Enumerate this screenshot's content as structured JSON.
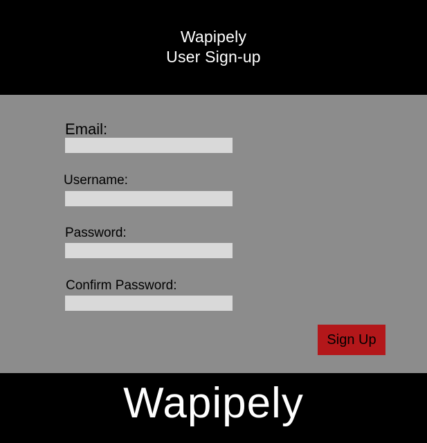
{
  "header": {
    "app_name": "Wapipely",
    "page_title": "User Sign-up"
  },
  "form": {
    "email": {
      "label": "Email:",
      "value": "",
      "placeholder": ""
    },
    "username": {
      "label": "Username:",
      "value": "",
      "placeholder": ""
    },
    "password": {
      "label": "Password:",
      "value": "",
      "placeholder": ""
    },
    "confirm_password": {
      "label": "Confirm Password:",
      "value": "",
      "placeholder": ""
    },
    "submit_label": "Sign Up"
  },
  "footer": {
    "brand": "Wapipely"
  },
  "colors": {
    "header_bg": "#000000",
    "form_bg": "#8c8c8c",
    "field_bg": "#d9d9d9",
    "button_bg": "#b3171a",
    "footer_bg": "#000000"
  }
}
